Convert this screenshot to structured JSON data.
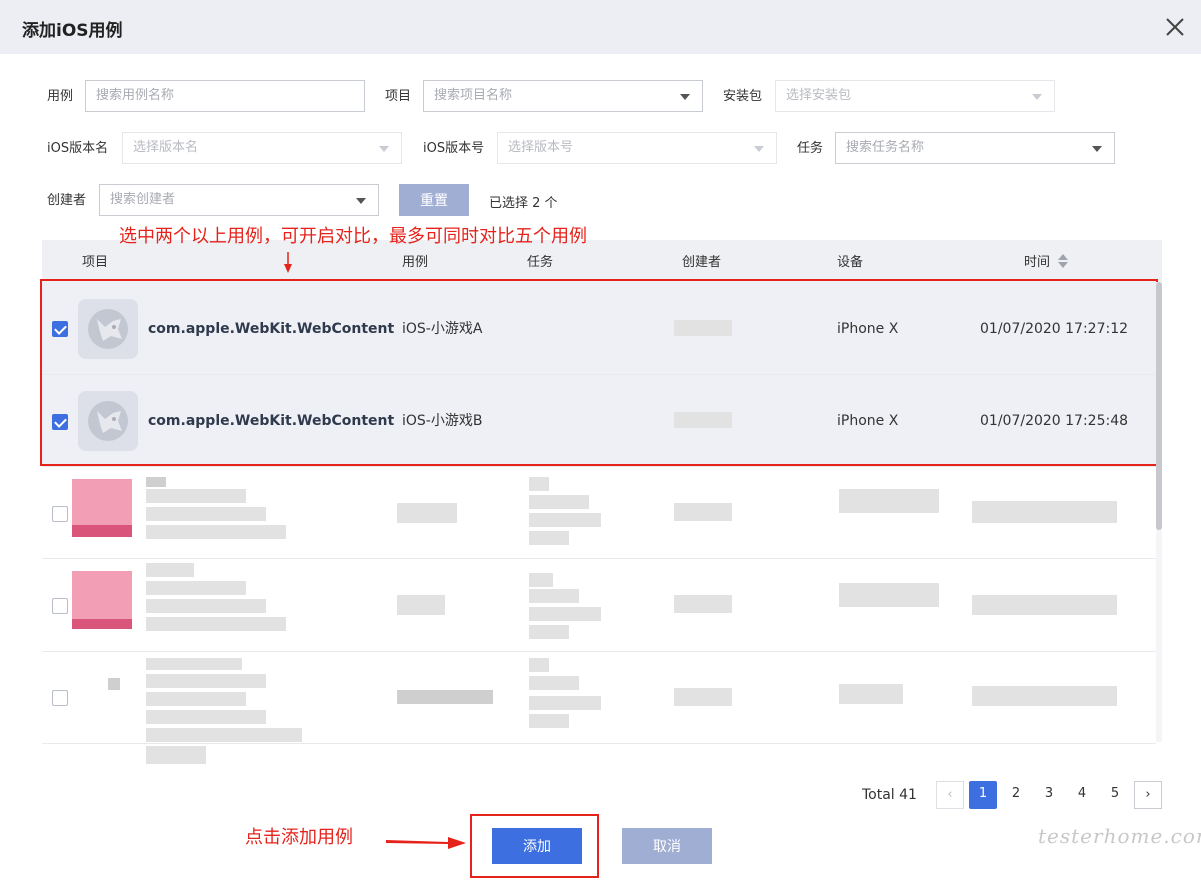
{
  "dialog": {
    "title": "添加iOS用例"
  },
  "filters": {
    "case": {
      "label": "用例",
      "placeholder": "搜索用例名称"
    },
    "project": {
      "label": "项目",
      "placeholder": "搜索项目名称"
    },
    "package": {
      "label": "安装包",
      "placeholder": "选择安装包"
    },
    "ios_version_name": {
      "label": "iOS版本名",
      "placeholder": "选择版本名"
    },
    "ios_version_code": {
      "label": "iOS版本号",
      "placeholder": "选择版本号"
    },
    "task": {
      "label": "任务",
      "placeholder": "搜索任务名称"
    },
    "creator": {
      "label": "创建者",
      "placeholder": "搜索创建者"
    },
    "reset_label": "重置",
    "selected_text": "已选择 2 个"
  },
  "annotations": {
    "compare_hint": "选中两个以上用例，可开启对比，最多可同时对比五个用例",
    "add_hint": "点击添加用例"
  },
  "table": {
    "columns": [
      "项目",
      "用例",
      "任务",
      "创建者",
      "设备",
      "时间"
    ],
    "rows": [
      {
        "checked": true,
        "project": "com.apple.WebKit.WebContent",
        "case": "iOS-小游戏A",
        "device": "iPhone X",
        "time": "01/07/2020 17:27:12"
      },
      {
        "checked": true,
        "project": "com.apple.WebKit.WebContent",
        "case": "iOS-小游戏B",
        "device": "iPhone X",
        "time": "01/07/2020 17:25:48"
      }
    ]
  },
  "pagination": {
    "total": "Total 41",
    "pages": [
      "1",
      "2",
      "3",
      "4",
      "5"
    ],
    "current": "1",
    "prev": "‹",
    "next": "›"
  },
  "footer": {
    "add_label": "添加",
    "cancel_label": "取消"
  },
  "watermark": "testerhome.com",
  "colors": {
    "primary": "#3d6fe0",
    "secondary": "#a1aed4",
    "annotation": "#e5231b"
  }
}
